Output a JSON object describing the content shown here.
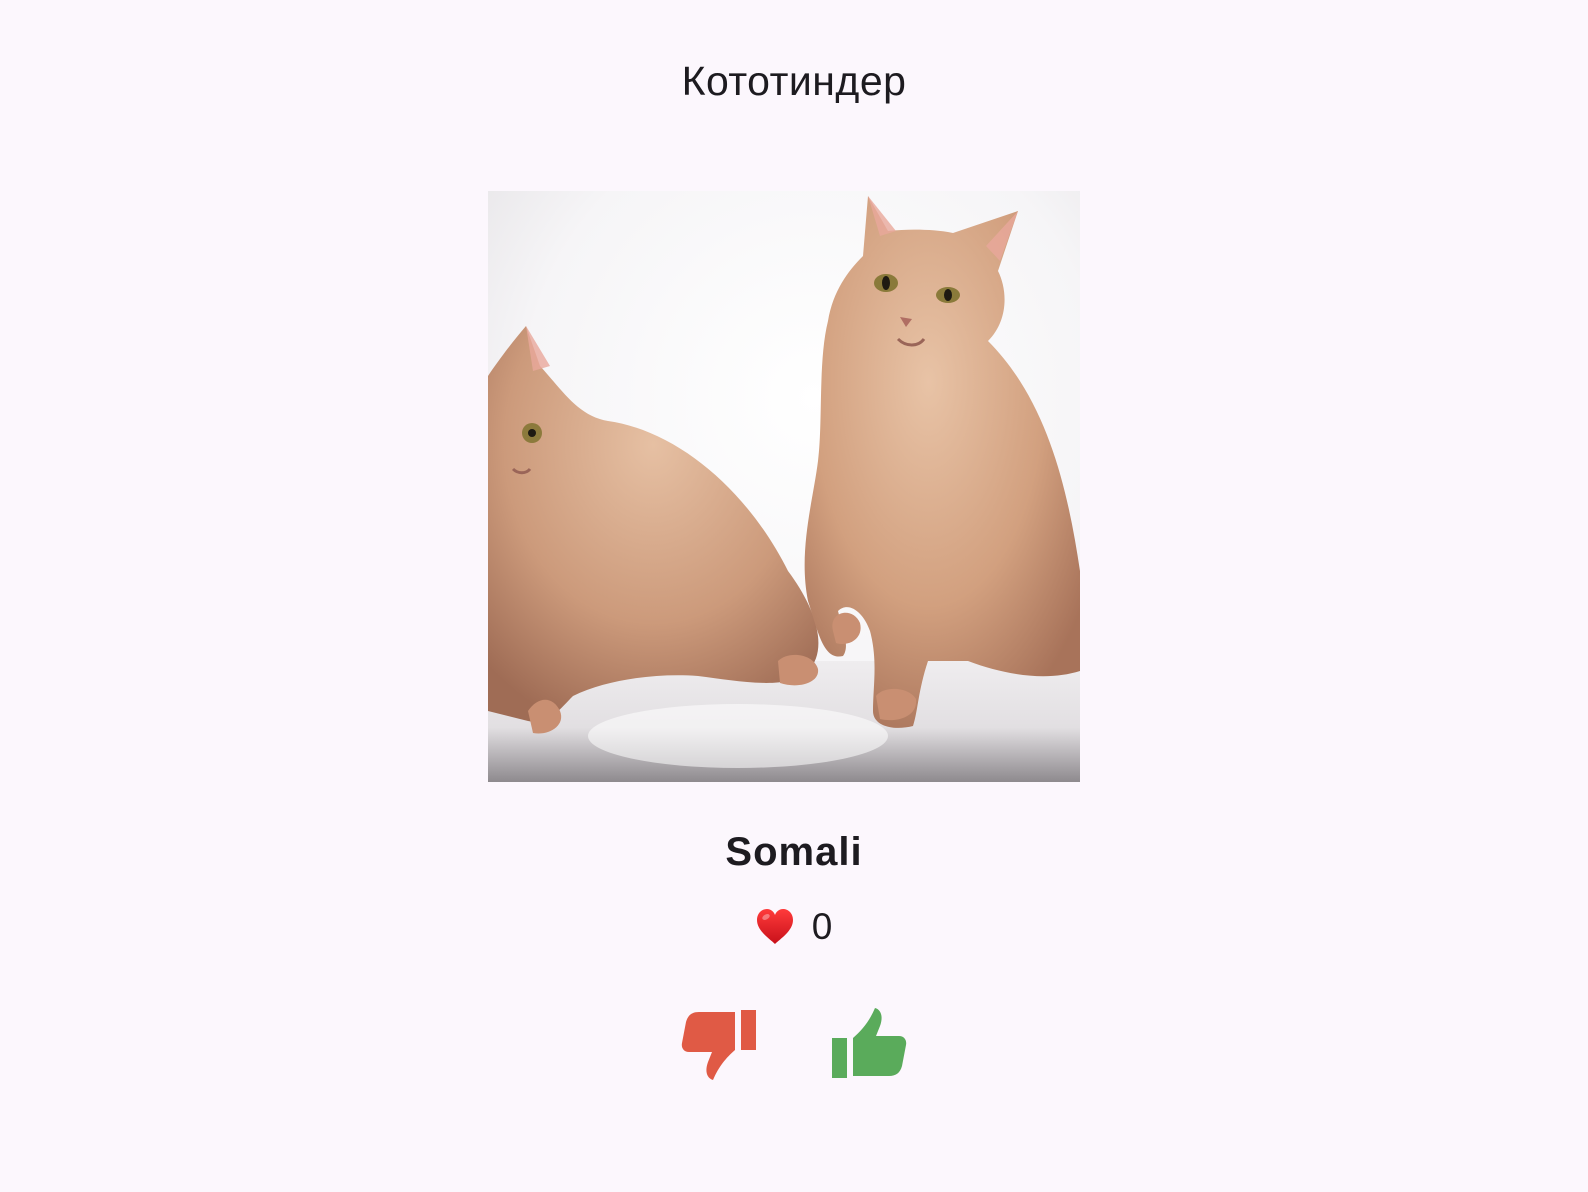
{
  "app": {
    "title": "Кототиндер"
  },
  "card": {
    "photo_alt": "Somali",
    "breed_name": "Somali",
    "likes_icon": "heart-icon",
    "likes_count": "0"
  },
  "actions": {
    "dislike_icon": "thumbs-down-icon",
    "like_icon": "thumbs-up-icon"
  },
  "colors": {
    "background": "#fcf7fd",
    "text": "#1d1b20",
    "heart": "#e1262d",
    "dislike": "#e05a45",
    "like": "#5aab5b"
  }
}
